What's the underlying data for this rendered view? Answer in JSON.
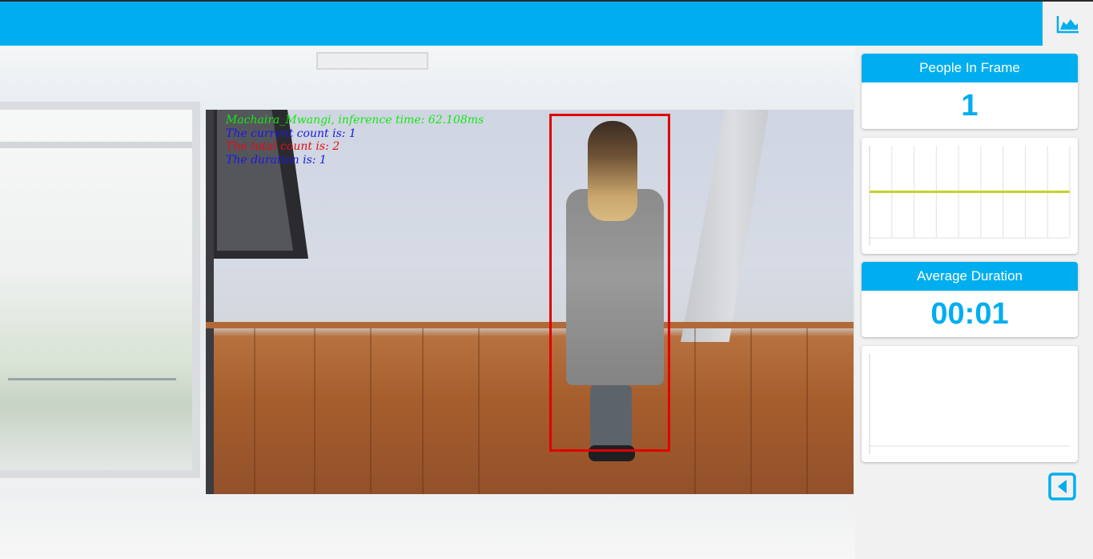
{
  "header": {
    "stats_toggle_icon": "area-chart-icon"
  },
  "video": {
    "overlay": {
      "inference_text": "Machaira_Mwangi, inference time: 62.108ms",
      "current_count_text": "The current count is: 1",
      "total_count_text": "The total count is: 2",
      "duration_text": "The duration is: 1"
    }
  },
  "stats": {
    "people_in_frame": {
      "label": "People In Frame",
      "value": "1"
    },
    "people_chart": {
      "line_color": "#c6d22c",
      "grid_color": "#e2e2e2",
      "level": 0.5
    },
    "average_duration": {
      "label": "Average Duration",
      "value": "00:01"
    },
    "duration_chart": {
      "grid_color": "#e2e2e2"
    },
    "back_icon": "caret-left-icon"
  },
  "colors": {
    "accent": "#00aeef",
    "bbox": "#e00000"
  }
}
